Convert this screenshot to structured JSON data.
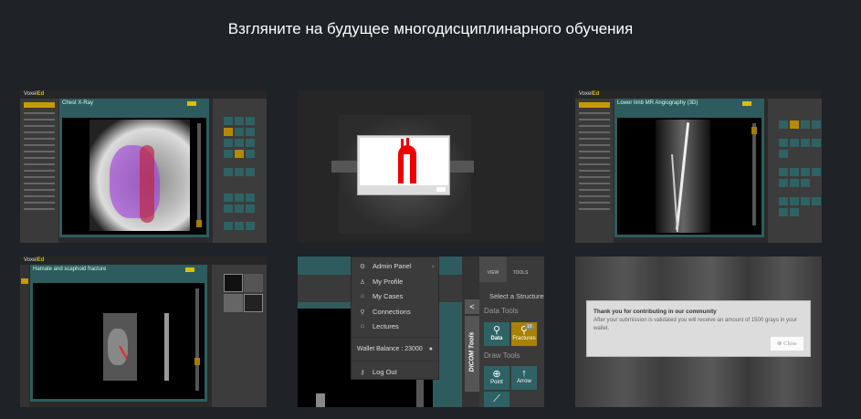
{
  "heading": "Взгляните на будущее многодисциплинарного обучения",
  "colors": {
    "background": "#1f2226",
    "teal": "#2e6264",
    "gold": "#b58a00"
  },
  "tiles": [
    {
      "logo": "Voxel",
      "logo_accent": "Ed",
      "title": "Chest X-Ray"
    },
    {
      "note": "aorta diagram modal"
    },
    {
      "logo": "Voxel",
      "logo_accent": "Ed",
      "title": "Lower limb MR Angiography (3D)"
    },
    {
      "logo": "Voxel",
      "logo_accent": "Ed",
      "title": "Hamate and scaphoid fracture"
    },
    {
      "menu": [
        {
          "icon": "gear-icon",
          "glyph": "⚙",
          "label": "Admin Panel"
        },
        {
          "icon": "user-icon",
          "glyph": "♙",
          "label": "My Profile"
        },
        {
          "icon": "home-icon",
          "glyph": "⌂",
          "label": "My Cases"
        },
        {
          "icon": "link-icon",
          "glyph": "⚲",
          "label": "Connections"
        },
        {
          "icon": "home-icon",
          "glyph": "⌂",
          "label": "Lectures"
        }
      ],
      "wallet": "Wallet Balance : 23000",
      "logout": "Log Out",
      "tabs": [
        "VIEW",
        "TOOLS"
      ],
      "dicom_tab": "DICOM Tools",
      "select_structure": "Select a Structure",
      "data_tools": "Data Tools",
      "data_btn": "Data",
      "fractures_btn": "Fractures",
      "fractures_badge": "10",
      "draw_tools": "Draw Tools",
      "point_btn": "Point",
      "arrow_btn": "Arrow"
    },
    {
      "dialog_title": "Thank you for contributing in our community",
      "dialog_body": "After your submission is validated you will receive an amount of 1500 grays in your wallet.",
      "close": "Close"
    }
  ]
}
